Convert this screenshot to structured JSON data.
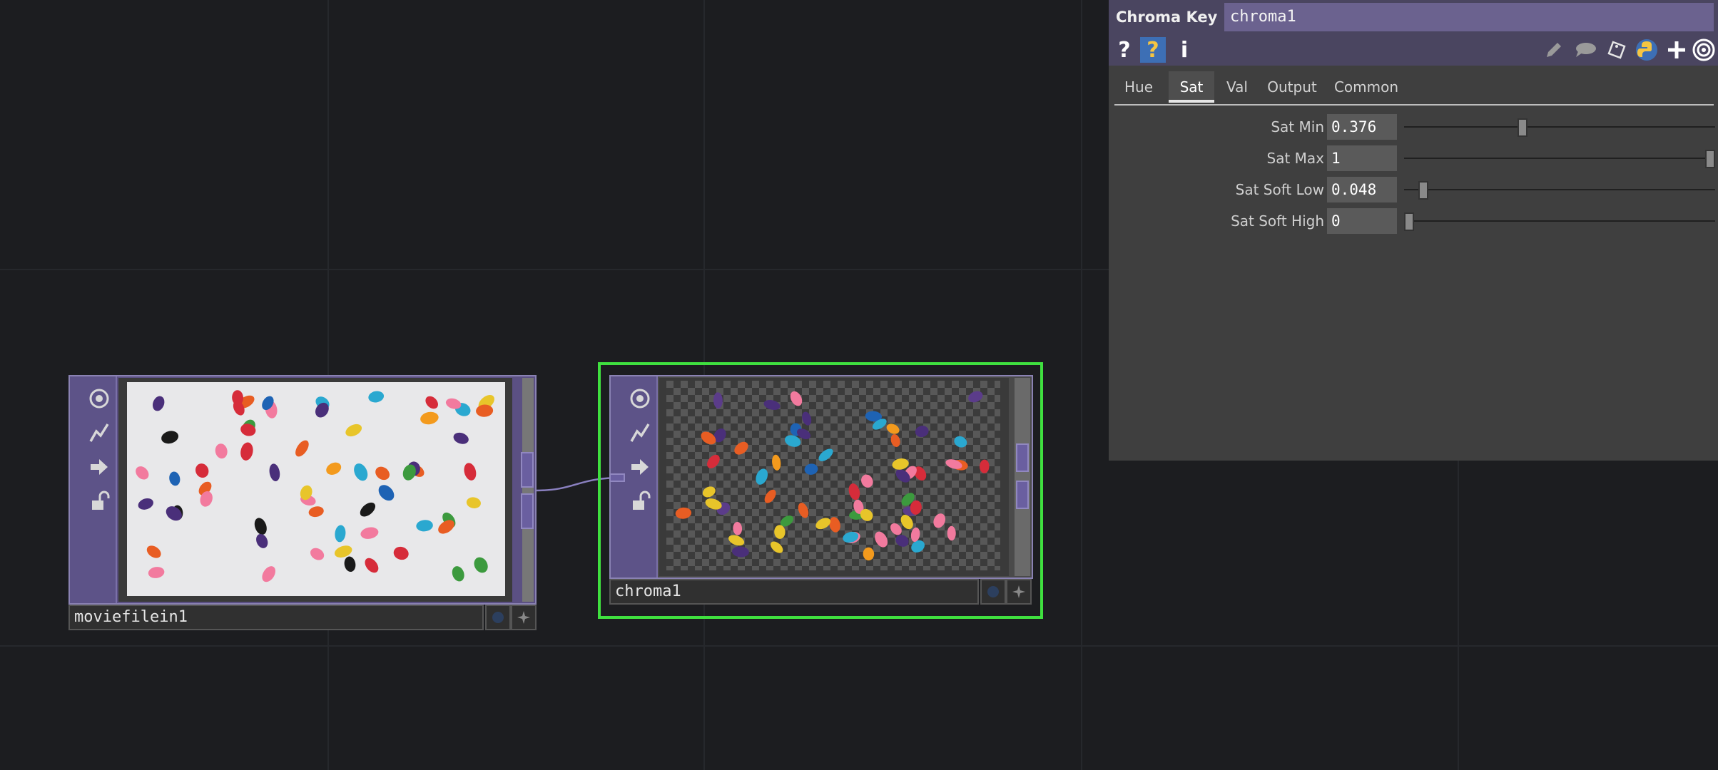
{
  "node_network": {
    "nodes": [
      {
        "name": "moviefilein1"
      },
      {
        "name": "chroma1"
      }
    ]
  },
  "parameter_panel": {
    "op_type": "Chroma Key",
    "op_name": "chroma1",
    "toolbar": {
      "help_icon": "?",
      "python_help_icon": "?",
      "info_icon": "i"
    },
    "tabs": [
      {
        "label": "Hue"
      },
      {
        "label": "Sat",
        "active": true
      },
      {
        "label": "Val"
      },
      {
        "label": "Output"
      },
      {
        "label": "Common"
      }
    ],
    "params": [
      {
        "label": "Sat Min",
        "value": "0.376",
        "slider_fraction": 0.376
      },
      {
        "label": "Sat Max",
        "value": "1",
        "slider_fraction": 1.0
      },
      {
        "label": "Sat Soft Low",
        "value": "0.048",
        "slider_fraction": 0.048
      },
      {
        "label": "Sat Soft High",
        "value": "0",
        "slider_fraction": 0.0
      }
    ]
  },
  "colors": {
    "background": "#1c1d20",
    "node_strip": "#5d5388",
    "selection": "#3fe03f",
    "panel": "#3f3f3f",
    "panel_header": "#4a4560"
  },
  "icons": [
    "viewer-flag-icon",
    "bypass-flag-icon",
    "display-flag-icon",
    "lock-flag-icon",
    "help-icon",
    "python-help-icon",
    "info-icon",
    "edit-icon",
    "comment-icon",
    "tag-icon",
    "python-icon",
    "add-icon",
    "target-icon"
  ]
}
